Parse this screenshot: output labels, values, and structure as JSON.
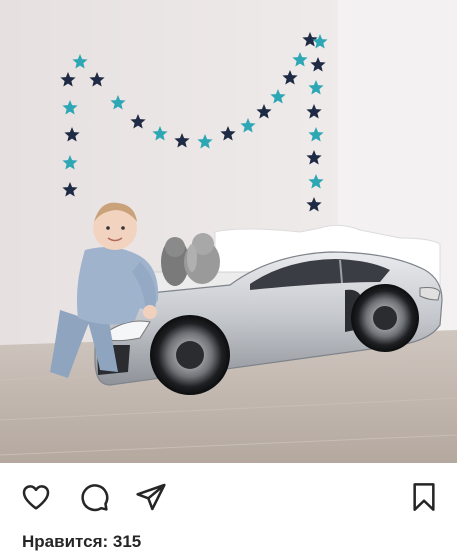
{
  "post": {
    "photo_alt": "photo",
    "likes_text": "Нравится: 315"
  },
  "actions": {
    "like_icon": "heart-icon",
    "comment_icon": "comment-icon",
    "share_icon": "share-icon",
    "save_icon": "bookmark-icon"
  },
  "colors": {
    "text": "#262626",
    "star_teal": "#2ea7b5",
    "star_navy": "#1f2a44",
    "wall": "#ece8e8",
    "floor": "#bdb3ab",
    "car_body": "#c9ccd0"
  }
}
